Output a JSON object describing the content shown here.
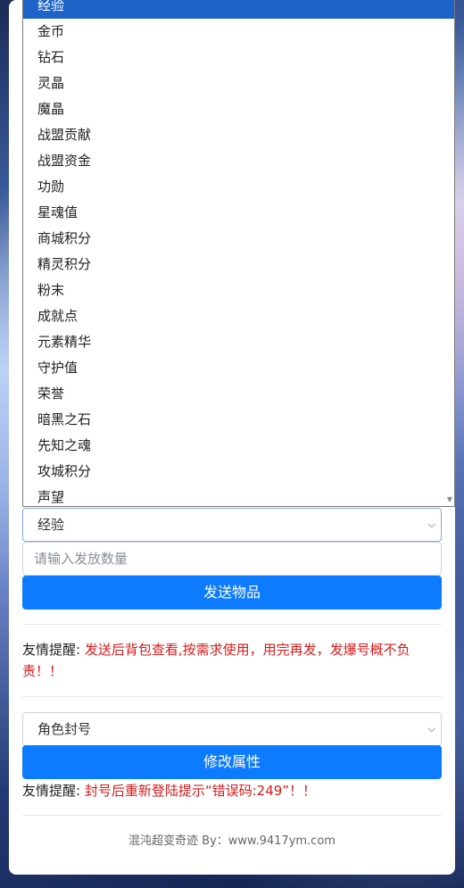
{
  "dropdown": {
    "options": [
      "经验",
      "金币",
      "钻石",
      "灵晶",
      "魔晶",
      "战盟贡献",
      "战盟资金",
      "功勋",
      "星魂值",
      "商城积分",
      "精灵积分",
      "粉末",
      "成就点",
      "元素精华",
      "守护值",
      "荣誉",
      "暗黑之石",
      "先知之魂",
      "攻城积分",
      "声望"
    ],
    "selected_index": 0,
    "scroll_arrow": "chevron-down-icon"
  },
  "send_form": {
    "item_select_value": "经验",
    "quantity_placeholder": "请输入发放数量",
    "send_button": "发送物品"
  },
  "reminder1": {
    "label": "友情提醒:",
    "text": "发送后背包查看,按需求使用，用完再发，发爆号概不负责！！"
  },
  "attr_form": {
    "select_value": "角色封号",
    "modify_button": "修改属性"
  },
  "reminder2": {
    "label": "友情提醒:",
    "text": "封号后重新登陆提示“错误码:249”！！"
  },
  "footer": {
    "text": "混沌超变奇迹 By：www.9417ym.com"
  },
  "colors": {
    "primary": "#0d7bff",
    "warning_text": "#d41b1b",
    "selected_option": "#1e64c8"
  }
}
